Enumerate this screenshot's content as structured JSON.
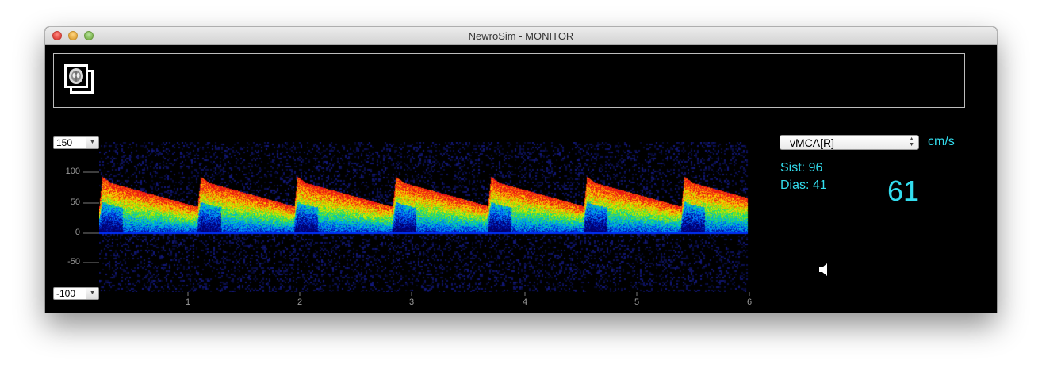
{
  "window": {
    "title": "NewroSim - MONITOR"
  },
  "scale": {
    "max": "150",
    "min": "-100"
  },
  "axis": {
    "y_ticks": [
      "100",
      "50",
      "0",
      "-50"
    ],
    "x_ticks": [
      "1",
      "2",
      "3",
      "4",
      "5",
      "6"
    ]
  },
  "channel": {
    "selected": "vMCA[R]",
    "unit": "cm/s"
  },
  "readouts": {
    "sist": "Sist: 96",
    "dias": "Dias: 41",
    "mean": "61"
  },
  "colors": {
    "readout": "#33ddee",
    "background": "#000000"
  },
  "icons": {
    "scan": "brain-scan-icon",
    "speaker": "speaker-icon"
  }
}
